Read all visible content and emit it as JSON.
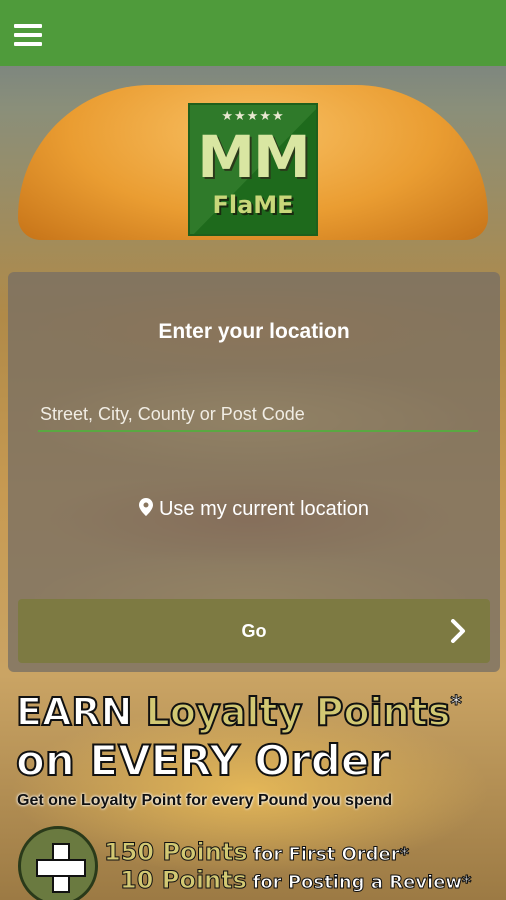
{
  "header": {
    "menu_icon": "hamburger-menu-icon",
    "bar_color": "#4f9b3b"
  },
  "logo": {
    "stars": "★★★★★",
    "mm": "MM",
    "flame": "FlaME"
  },
  "location_panel": {
    "title": "Enter your location",
    "input_placeholder": "Street, City, County or Post Code",
    "input_value": "",
    "use_current_location": "Use my current location",
    "pin_icon": "location-pin-icon",
    "go_label": "Go",
    "go_icon": "chevron-right-icon"
  },
  "promo": {
    "earn": "EARN",
    "loyalty_points": "Loyalty Points",
    "asterisk": "*",
    "on_every_order": "on EVERY Order",
    "subtitle": "Get one Loyalty Point for every Pound you spend",
    "row1_points": "150 Points",
    "row1_text": "for First Order*",
    "row2_points": "10 Points",
    "row2_text": "for Posting a Review*"
  }
}
